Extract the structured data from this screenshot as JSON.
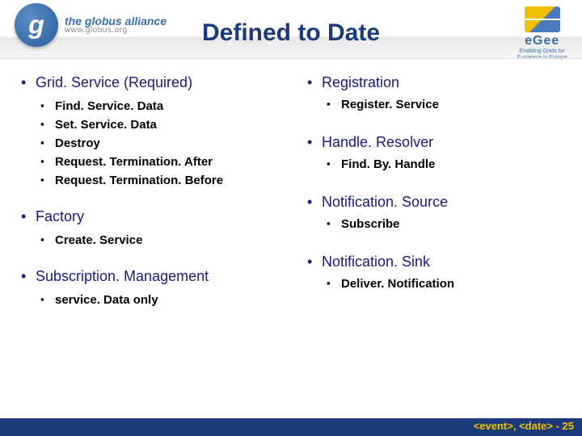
{
  "header": {
    "title": "Defined to Date",
    "globus": {
      "g": "g",
      "line1": "the globus alliance",
      "line2": "www.globus.org"
    },
    "egee": {
      "name": "eGee",
      "tag": "Enabling Grids for\nE-science in Europe"
    }
  },
  "left": [
    {
      "label": "Grid. Service (Required)",
      "sub": [
        "Find. Service. Data",
        "Set. Service. Data",
        "Destroy",
        "Request. Termination. After",
        "Request. Termination. Before"
      ]
    },
    {
      "label": "Factory",
      "sub": [
        "Create. Service"
      ]
    },
    {
      "label": "Subscription. Management",
      "sub": [
        "service. Data only"
      ]
    }
  ],
  "right": [
    {
      "label": "Registration",
      "sub": [
        "Register. Service"
      ]
    },
    {
      "label": "Handle. Resolver",
      "sub": [
        "Find. By. Handle"
      ]
    },
    {
      "label": "Notification. Source",
      "sub": [
        "Subscribe"
      ]
    },
    {
      "label": "Notification. Sink",
      "sub": [
        "Deliver. Notification"
      ]
    }
  ],
  "footer": "<event>, <date>  - 25"
}
